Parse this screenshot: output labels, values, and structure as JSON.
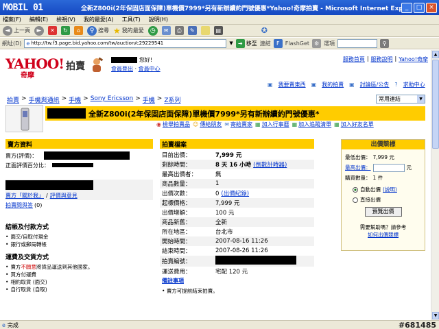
{
  "window": {
    "logo_text": "MOBIL 01",
    "title": "全新Z800i(2年保固店面保障)單機價7999*另有新辦續約門號優惠*Yahoo!奇摩拍賣 - Microsoft Internet Explorer",
    "minimize": "_",
    "maximize": "□",
    "close": "×"
  },
  "menu": [
    "檔案(F)",
    "編輯(E)",
    "檢視(V)",
    "我的最愛(A)",
    "工具(T)",
    "說明(H)"
  ],
  "toolbar": {
    "back": "上一頁",
    "forward": "",
    "search": "搜尋",
    "favorites": "我的最愛"
  },
  "address": {
    "label": "網址(D)",
    "url": "http://tw.f3.page.bid.yahoo.com/tw/auction/c29229541",
    "go": "移至",
    "links": "連結",
    "flashget": "FlashGet",
    "options": "選項"
  },
  "header": {
    "logo": "YAHOO!",
    "logo_sub": "奇摩",
    "auction": "拍賣",
    "greeting": "您好!",
    "login_link": "會員登出",
    "member_center": "會員中心",
    "top_links": [
      "服務首頁",
      "服務說明",
      "Yahoo!奇摩"
    ],
    "sub_links": [
      "我要賣東西",
      "我的拍賣",
      "討論區/公告",
      "求助中心"
    ]
  },
  "breadcrumb": [
    "拍賣",
    "手機與通訊",
    "手機",
    "Sony Ericsson",
    "手機",
    "Z系列"
  ],
  "view_select": "常用連結",
  "listing": {
    "title": "全新Z800i(2年保固店面保障)單機價7999*另有新辦續約門號優惠*",
    "actions": [
      "檢舉拍賣品",
      "傳給朋友",
      "寄給賣家",
      "加入行事曆",
      "加入追蹤清單",
      "加入好友名單"
    ]
  },
  "seller": {
    "header": "賣方資料",
    "seller_label": "賣方(評價)：",
    "positive_label": "正面評價百分比：",
    "about_link": "賣方「關於我」",
    "feedback_link": "評價與意見",
    "qa_link": "拍賣問與答",
    "qa_count": "(0)",
    "payment_header": "結帳及付款方式",
    "payment_items": [
      "面交/自取付現金",
      "銀行或郵局轉帳"
    ],
    "shipping_header": "運費及交貨方式",
    "shipping_prefix": "賣方",
    "shipping_em": "不願意",
    "shipping_suffix": "將貨品運送到其他國家。",
    "shipping_items": [
      "買方付運費",
      "相約取貨 (面交)",
      "自行取貨 (自取)"
    ]
  },
  "bid": {
    "header": "拍賣檔案",
    "rows": [
      {
        "k": "目前出價：",
        "v": "7,999 元"
      },
      {
        "k": "剩餘時間：",
        "v": "8 天 16 小時",
        "link": "(倒數計時器)"
      },
      {
        "k": "最高出價者：",
        "v": "無"
      },
      {
        "k": "商品數量：",
        "v": "1"
      },
      {
        "k": "出價次數：",
        "v": "0",
        "link": "(出價紀錄)"
      },
      {
        "k": "起標價格：",
        "v": "7,999 元"
      },
      {
        "k": "出價增額：",
        "v": "100 元"
      },
      {
        "k": "商品新舊：",
        "v": "全新"
      },
      {
        "k": "所在地區：",
        "v": "台北市"
      },
      {
        "k": "開始時間：",
        "v": "2007-08-16 11:26"
      },
      {
        "k": "結束時間：",
        "v": "2007-08-26 11:26"
      },
      {
        "k": "拍賣編號：",
        "v": ""
      },
      {
        "k": "運送費用：",
        "v": "宅配 120 元"
      }
    ],
    "notice_link": "備註事項",
    "early_end": "賣方可提前結束拍賣。"
  },
  "bidbox": {
    "header": "出價競標",
    "min_label": "最低出價：",
    "min_value": "7,999 元",
    "max_label": "最高出價：",
    "max_unit": "元",
    "qty_label": "購買數量：",
    "qty_value": "1 件",
    "auto_label": "自動出價",
    "auto_link": "(說明)",
    "direct_label": "直接出價",
    "preview_button": "預覽出價",
    "help1": "需要幫助嗎？請參考",
    "help2": "如何出價競標"
  },
  "status": {
    "text": "完成",
    "watermark": "#681485"
  }
}
